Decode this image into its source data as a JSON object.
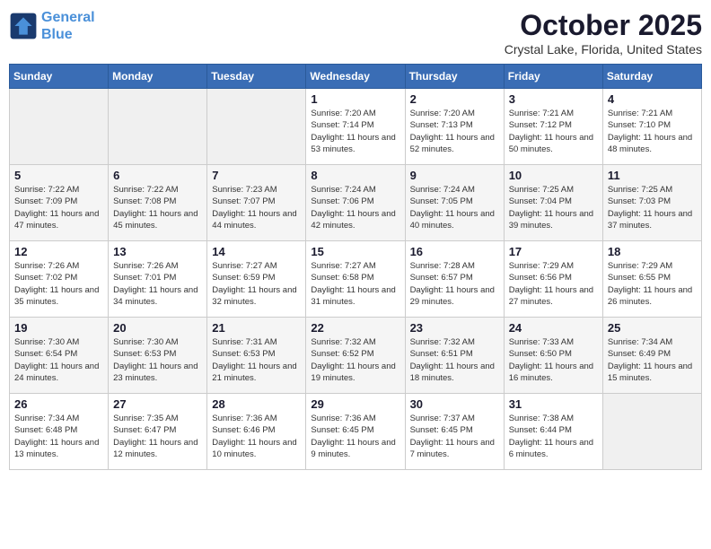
{
  "logo": {
    "line1": "General",
    "line2": "Blue"
  },
  "title": "October 2025",
  "location": "Crystal Lake, Florida, United States",
  "weekdays": [
    "Sunday",
    "Monday",
    "Tuesday",
    "Wednesday",
    "Thursday",
    "Friday",
    "Saturday"
  ],
  "weeks": [
    [
      {
        "day": "",
        "sunrise": "",
        "sunset": "",
        "daylight": ""
      },
      {
        "day": "",
        "sunrise": "",
        "sunset": "",
        "daylight": ""
      },
      {
        "day": "",
        "sunrise": "",
        "sunset": "",
        "daylight": ""
      },
      {
        "day": "1",
        "sunrise": "Sunrise: 7:20 AM",
        "sunset": "Sunset: 7:14 PM",
        "daylight": "Daylight: 11 hours and 53 minutes."
      },
      {
        "day": "2",
        "sunrise": "Sunrise: 7:20 AM",
        "sunset": "Sunset: 7:13 PM",
        "daylight": "Daylight: 11 hours and 52 minutes."
      },
      {
        "day": "3",
        "sunrise": "Sunrise: 7:21 AM",
        "sunset": "Sunset: 7:12 PM",
        "daylight": "Daylight: 11 hours and 50 minutes."
      },
      {
        "day": "4",
        "sunrise": "Sunrise: 7:21 AM",
        "sunset": "Sunset: 7:10 PM",
        "daylight": "Daylight: 11 hours and 48 minutes."
      }
    ],
    [
      {
        "day": "5",
        "sunrise": "Sunrise: 7:22 AM",
        "sunset": "Sunset: 7:09 PM",
        "daylight": "Daylight: 11 hours and 47 minutes."
      },
      {
        "day": "6",
        "sunrise": "Sunrise: 7:22 AM",
        "sunset": "Sunset: 7:08 PM",
        "daylight": "Daylight: 11 hours and 45 minutes."
      },
      {
        "day": "7",
        "sunrise": "Sunrise: 7:23 AM",
        "sunset": "Sunset: 7:07 PM",
        "daylight": "Daylight: 11 hours and 44 minutes."
      },
      {
        "day": "8",
        "sunrise": "Sunrise: 7:24 AM",
        "sunset": "Sunset: 7:06 PM",
        "daylight": "Daylight: 11 hours and 42 minutes."
      },
      {
        "day": "9",
        "sunrise": "Sunrise: 7:24 AM",
        "sunset": "Sunset: 7:05 PM",
        "daylight": "Daylight: 11 hours and 40 minutes."
      },
      {
        "day": "10",
        "sunrise": "Sunrise: 7:25 AM",
        "sunset": "Sunset: 7:04 PM",
        "daylight": "Daylight: 11 hours and 39 minutes."
      },
      {
        "day": "11",
        "sunrise": "Sunrise: 7:25 AM",
        "sunset": "Sunset: 7:03 PM",
        "daylight": "Daylight: 11 hours and 37 minutes."
      }
    ],
    [
      {
        "day": "12",
        "sunrise": "Sunrise: 7:26 AM",
        "sunset": "Sunset: 7:02 PM",
        "daylight": "Daylight: 11 hours and 35 minutes."
      },
      {
        "day": "13",
        "sunrise": "Sunrise: 7:26 AM",
        "sunset": "Sunset: 7:01 PM",
        "daylight": "Daylight: 11 hours and 34 minutes."
      },
      {
        "day": "14",
        "sunrise": "Sunrise: 7:27 AM",
        "sunset": "Sunset: 6:59 PM",
        "daylight": "Daylight: 11 hours and 32 minutes."
      },
      {
        "day": "15",
        "sunrise": "Sunrise: 7:27 AM",
        "sunset": "Sunset: 6:58 PM",
        "daylight": "Daylight: 11 hours and 31 minutes."
      },
      {
        "day": "16",
        "sunrise": "Sunrise: 7:28 AM",
        "sunset": "Sunset: 6:57 PM",
        "daylight": "Daylight: 11 hours and 29 minutes."
      },
      {
        "day": "17",
        "sunrise": "Sunrise: 7:29 AM",
        "sunset": "Sunset: 6:56 PM",
        "daylight": "Daylight: 11 hours and 27 minutes."
      },
      {
        "day": "18",
        "sunrise": "Sunrise: 7:29 AM",
        "sunset": "Sunset: 6:55 PM",
        "daylight": "Daylight: 11 hours and 26 minutes."
      }
    ],
    [
      {
        "day": "19",
        "sunrise": "Sunrise: 7:30 AM",
        "sunset": "Sunset: 6:54 PM",
        "daylight": "Daylight: 11 hours and 24 minutes."
      },
      {
        "day": "20",
        "sunrise": "Sunrise: 7:30 AM",
        "sunset": "Sunset: 6:53 PM",
        "daylight": "Daylight: 11 hours and 23 minutes."
      },
      {
        "day": "21",
        "sunrise": "Sunrise: 7:31 AM",
        "sunset": "Sunset: 6:53 PM",
        "daylight": "Daylight: 11 hours and 21 minutes."
      },
      {
        "day": "22",
        "sunrise": "Sunrise: 7:32 AM",
        "sunset": "Sunset: 6:52 PM",
        "daylight": "Daylight: 11 hours and 19 minutes."
      },
      {
        "day": "23",
        "sunrise": "Sunrise: 7:32 AM",
        "sunset": "Sunset: 6:51 PM",
        "daylight": "Daylight: 11 hours and 18 minutes."
      },
      {
        "day": "24",
        "sunrise": "Sunrise: 7:33 AM",
        "sunset": "Sunset: 6:50 PM",
        "daylight": "Daylight: 11 hours and 16 minutes."
      },
      {
        "day": "25",
        "sunrise": "Sunrise: 7:34 AM",
        "sunset": "Sunset: 6:49 PM",
        "daylight": "Daylight: 11 hours and 15 minutes."
      }
    ],
    [
      {
        "day": "26",
        "sunrise": "Sunrise: 7:34 AM",
        "sunset": "Sunset: 6:48 PM",
        "daylight": "Daylight: 11 hours and 13 minutes."
      },
      {
        "day": "27",
        "sunrise": "Sunrise: 7:35 AM",
        "sunset": "Sunset: 6:47 PM",
        "daylight": "Daylight: 11 hours and 12 minutes."
      },
      {
        "day": "28",
        "sunrise": "Sunrise: 7:36 AM",
        "sunset": "Sunset: 6:46 PM",
        "daylight": "Daylight: 11 hours and 10 minutes."
      },
      {
        "day": "29",
        "sunrise": "Sunrise: 7:36 AM",
        "sunset": "Sunset: 6:45 PM",
        "daylight": "Daylight: 11 hours and 9 minutes."
      },
      {
        "day": "30",
        "sunrise": "Sunrise: 7:37 AM",
        "sunset": "Sunset: 6:45 PM",
        "daylight": "Daylight: 11 hours and 7 minutes."
      },
      {
        "day": "31",
        "sunrise": "Sunrise: 7:38 AM",
        "sunset": "Sunset: 6:44 PM",
        "daylight": "Daylight: 11 hours and 6 minutes."
      },
      {
        "day": "",
        "sunrise": "",
        "sunset": "",
        "daylight": ""
      }
    ]
  ]
}
